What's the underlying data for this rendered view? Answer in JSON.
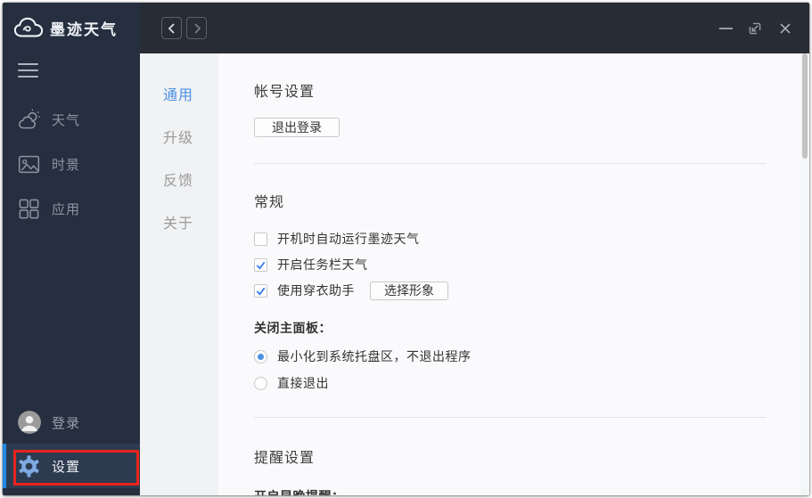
{
  "window": {
    "controls": {
      "back_icon": "chevron-left-icon",
      "forward_icon": "chevron-right-icon",
      "minimize_icon": "minimize-icon",
      "maximize_icon": "maximize-arrow-icon",
      "close_icon": "close-icon"
    }
  },
  "sidebar": {
    "logo_text": "墨迹天气",
    "menu_icon": "hamburger-icon",
    "nav_items": [
      {
        "label": "天气",
        "icon": "sun-cloud-icon"
      },
      {
        "label": "时景",
        "icon": "picture-icon"
      },
      {
        "label": "应用",
        "icon": "grid-apps-icon"
      }
    ],
    "bottom_items": [
      {
        "label": "登录",
        "icon": "avatar-icon",
        "active": false
      },
      {
        "label": "设置",
        "icon": "gear-icon",
        "active": true,
        "annotated": true
      }
    ]
  },
  "settings_nav": {
    "items": [
      {
        "label": "通用",
        "active": true
      },
      {
        "label": "升级",
        "active": false
      },
      {
        "label": "反馈",
        "active": false
      },
      {
        "label": "关于",
        "active": false
      }
    ]
  },
  "content": {
    "account_section": {
      "title": "帐号设置",
      "logout_button": "退出登录"
    },
    "general_section": {
      "title": "常规",
      "checkboxes": [
        {
          "label": "开机时自动运行墨迹天气",
          "checked": false
        },
        {
          "label": "开启任务栏天气",
          "checked": true
        },
        {
          "label": "使用穿衣助手",
          "checked": true,
          "button": "选择形象"
        }
      ],
      "close_panel_label": "关闭主面板：",
      "radios": [
        {
          "label": "最小化到系统托盘区，不退出程序",
          "selected": true
        },
        {
          "label": "直接退出",
          "selected": false
        }
      ]
    },
    "reminder_section": {
      "title": "提醒设置",
      "cutoff_label": "开启早晚提醒："
    }
  },
  "colors": {
    "accent": "#4a90e2",
    "accent_light": "#7ea9e2",
    "indicator": "#1f89e4",
    "annotation": "#e8231d",
    "sidebar_bg": "#252f3f",
    "sidebar_active_bg": "#2d3b50",
    "topbar_bg": "#272c35",
    "subnav_bg": "#f1f2f4",
    "main_bg": "#fafafc"
  }
}
